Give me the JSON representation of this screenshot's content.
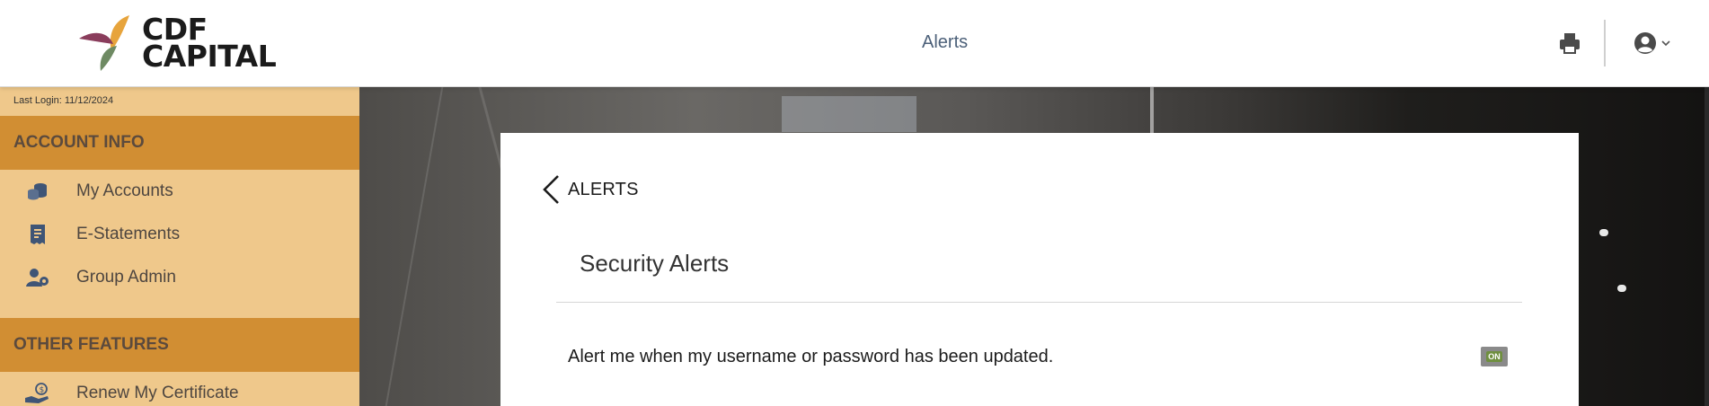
{
  "brand": {
    "logo_line1": "CDF",
    "logo_line2": "CAPITAL",
    "colors": {
      "purple": "#8a3d5c",
      "orange": "#e7a43c",
      "green": "#6e8a63"
    }
  },
  "header": {
    "title": "Alerts",
    "print_icon": "print-icon",
    "user_icon": "user-circle-icon"
  },
  "sidebar": {
    "last_login": "Last Login: 11/12/2024",
    "sections": [
      {
        "title": "ACCOUNT INFO",
        "items": [
          {
            "label": "My Accounts",
            "icon": "coins-icon"
          },
          {
            "label": "E-Statements",
            "icon": "document-icon"
          },
          {
            "label": "Group Admin",
            "icon": "users-gear-icon"
          }
        ]
      },
      {
        "title": "OTHER FEATURES",
        "items": [
          {
            "label": "Renew My Certificate",
            "icon": "hand-coin-icon"
          }
        ]
      }
    ]
  },
  "main": {
    "back_label": "ALERTS",
    "section_title": "Security Alerts",
    "alerts": [
      {
        "text": "Alert me when my username or password has been updated.",
        "toggle": "ON"
      }
    ]
  },
  "colors": {
    "sidebar_bg": "#efc88b",
    "section_header": "#d18e33",
    "header_title": "#4c6079"
  }
}
